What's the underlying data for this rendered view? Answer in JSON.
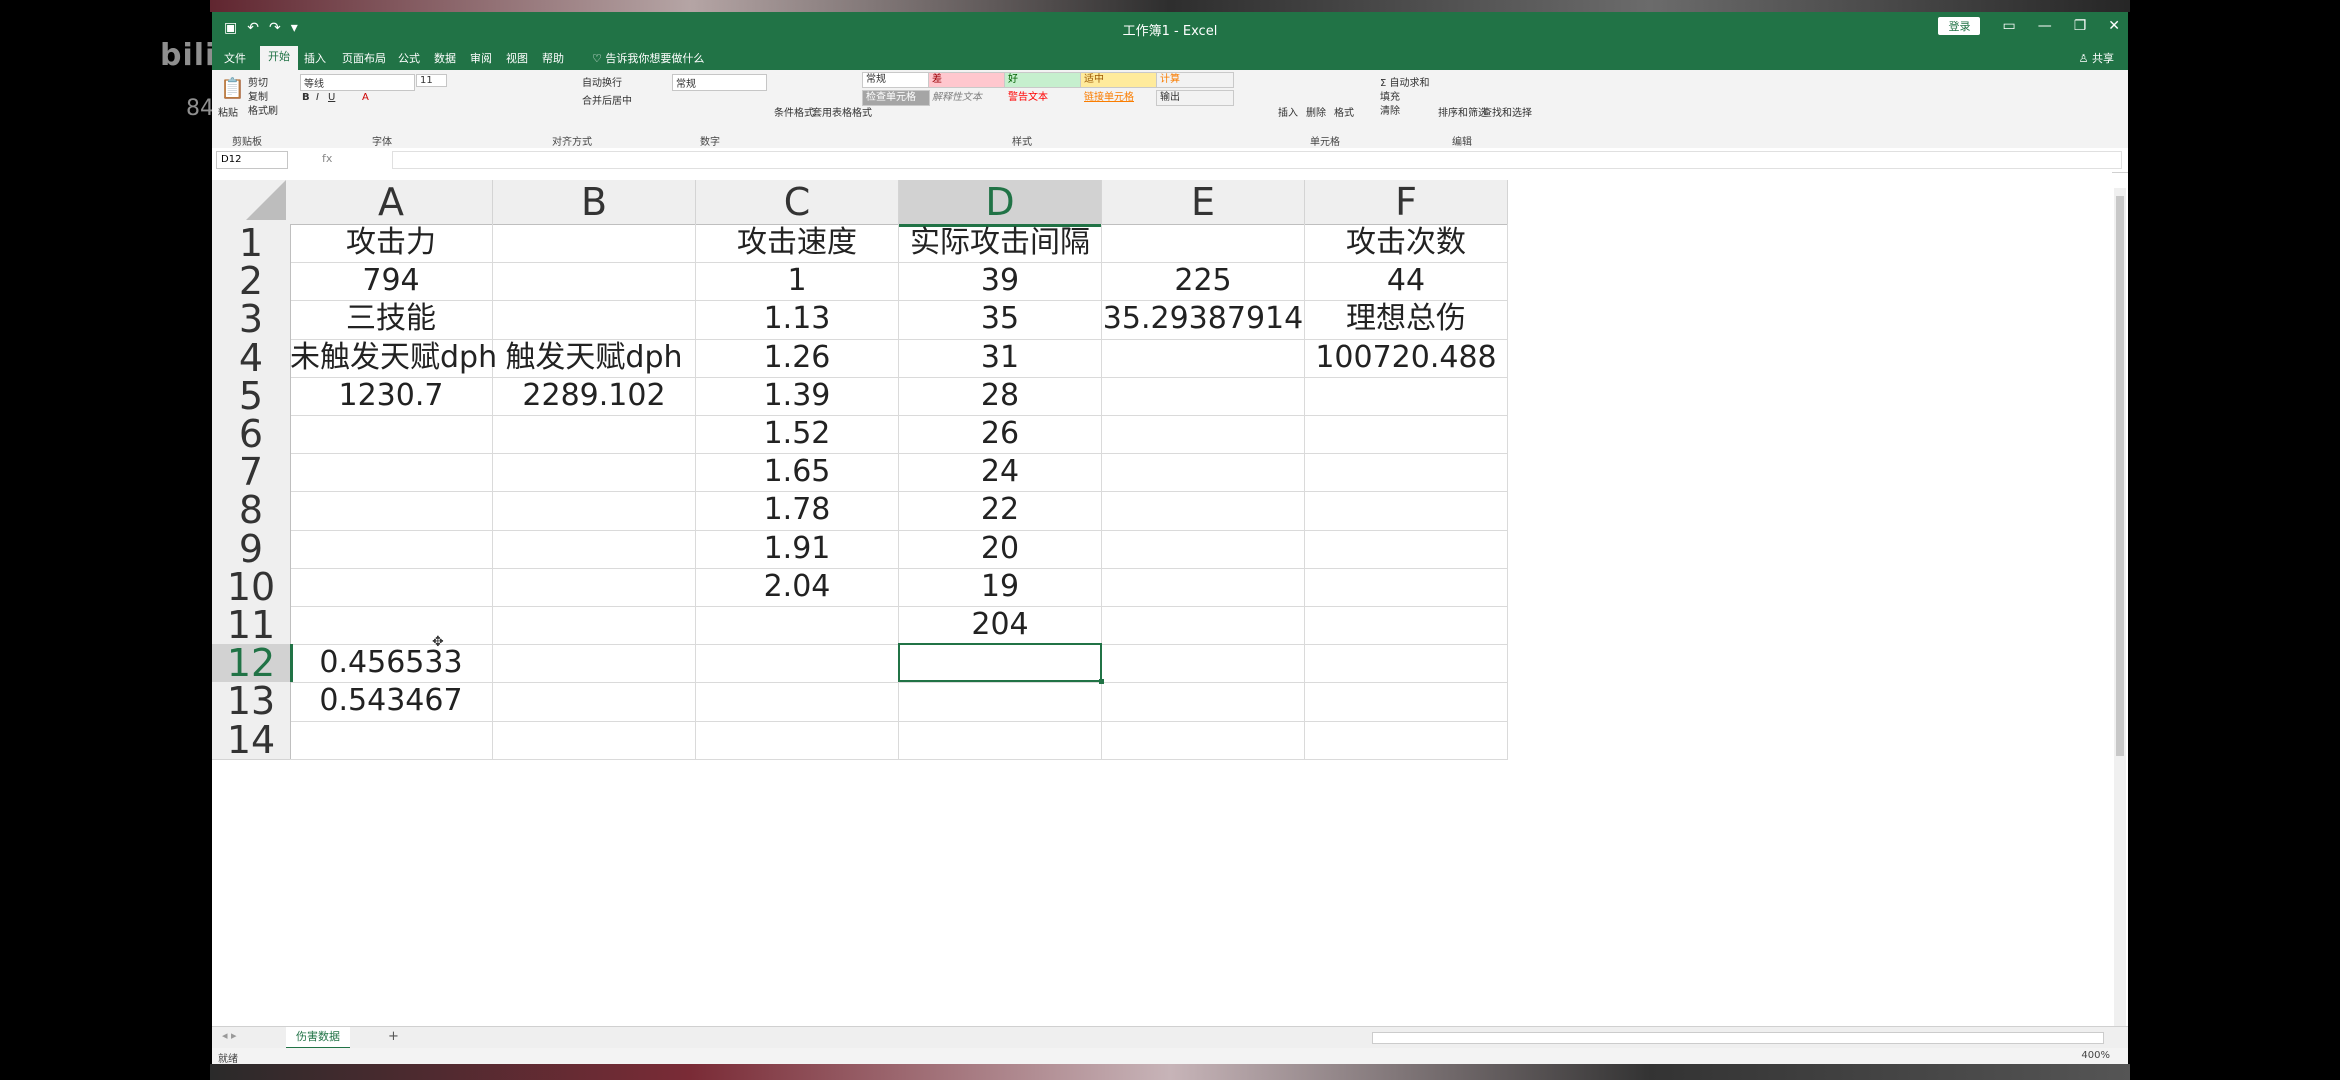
{
  "overlay": {
    "watermark": "bili",
    "watermark_sub": "84"
  },
  "app": {
    "title": "工作簿1 - Excel",
    "login_label": "登录",
    "share_label": "共享",
    "tabs": [
      "文件",
      "开始",
      "插入",
      "页面布局",
      "公式",
      "数据",
      "审阅",
      "视图",
      "帮助"
    ],
    "tell_me": "告诉我你想要做什么"
  },
  "ribbon": {
    "clipboard": {
      "paste": "粘贴",
      "cut": "剪切",
      "copy": "复制",
      "format_painter": "格式刷",
      "label": "剪贴板"
    },
    "font": {
      "name": "等线",
      "size": "11",
      "label": "字体"
    },
    "alignment": {
      "wrap": "自动换行",
      "merge": "合并后居中",
      "label": "对齐方式"
    },
    "number": {
      "format": "常规",
      "label": "数字"
    },
    "styles": {
      "conditional": "条件格式",
      "table": "套用表格格式",
      "items": [
        "常规",
        "差",
        "好",
        "适中",
        "计算",
        "检查单元格",
        "解释性文本",
        "警告文本",
        "链接单元格",
        "输出"
      ],
      "label": "样式"
    },
    "cells": {
      "insert": "插入",
      "delete": "删除",
      "format": "格式",
      "label": "单元格"
    },
    "editing": {
      "autosum": "自动求和",
      "fill": "填充",
      "clear": "清除",
      "sort": "排序和筛选",
      "find": "查找和选择",
      "label": "编辑"
    }
  },
  "formula_bar": {
    "name_box": "D12",
    "fx": "fx",
    "value": ""
  },
  "columns": [
    "A",
    "B",
    "C",
    "D",
    "E",
    "F"
  ],
  "selected_column": "D",
  "selected_row": "12",
  "rows": [
    {
      "n": "1",
      "cells": [
        "攻击力",
        "",
        "攻击速度",
        "实际攻击间隔",
        "",
        "攻击次数"
      ]
    },
    {
      "n": "2",
      "cells": [
        "794",
        "",
        "1",
        "39",
        "225",
        "44"
      ]
    },
    {
      "n": "3",
      "cells": [
        "三技能",
        "",
        "1.13",
        "35",
        "35.29387914",
        "理想总伤"
      ]
    },
    {
      "n": "4",
      "cells": [
        "未触发天赋dph",
        "触发天赋dph",
        "1.26",
        "31",
        "",
        "100720.488"
      ]
    },
    {
      "n": "5",
      "cells": [
        "1230.7",
        "2289.102",
        "1.39",
        "28",
        "",
        ""
      ]
    },
    {
      "n": "6",
      "cells": [
        "",
        "",
        "1.52",
        "26",
        "",
        ""
      ]
    },
    {
      "n": "7",
      "cells": [
        "",
        "",
        "1.65",
        "24",
        "",
        ""
      ]
    },
    {
      "n": "8",
      "cells": [
        "",
        "",
        "1.78",
        "22",
        "",
        ""
      ]
    },
    {
      "n": "9",
      "cells": [
        "",
        "",
        "1.91",
        "20",
        "",
        ""
      ]
    },
    {
      "n": "10",
      "cells": [
        "",
        "",
        "2.04",
        "19",
        "",
        ""
      ]
    },
    {
      "n": "11",
      "cells": [
        "",
        "",
        "",
        "204",
        "",
        ""
      ]
    },
    {
      "n": "12",
      "cells": [
        "0.456533",
        "",
        "",
        "",
        "",
        ""
      ]
    },
    {
      "n": "13",
      "cells": [
        "0.543467",
        "",
        "",
        "",
        "",
        ""
      ]
    },
    {
      "n": "14",
      "cells": [
        "",
        "",
        "",
        "",
        "",
        ""
      ]
    }
  ],
  "sheet": {
    "name": "伤害数据",
    "add": "+"
  },
  "status": {
    "ready": "就绪",
    "zoom": "400%"
  }
}
